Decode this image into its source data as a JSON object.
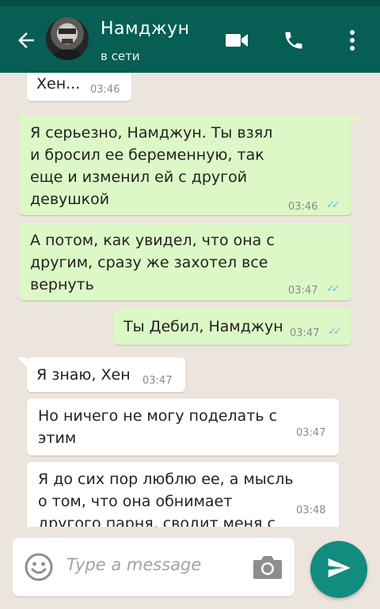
{
  "header": {
    "contact_name": "Намджун",
    "contact_status": "в сети"
  },
  "messages": [
    {
      "direction": "in",
      "text": "Хен...",
      "time": "03:46"
    },
    {
      "direction": "out",
      "lines": [
        "Я серьезно, Намджун. Ты взял",
        "и бросил ее беременную, так",
        "еще и изменил ей с другой",
        "девушкой"
      ],
      "time": "03:46",
      "status": "read"
    },
    {
      "direction": "out",
      "lines": [
        "А потом, как увидел, что она с",
        "другим, сразу же захотел все",
        "вернуть"
      ],
      "time": "03:47",
      "status": "read"
    },
    {
      "direction": "out",
      "text": "Ты Дебил, Намджун",
      "time": "03:47",
      "status": "read"
    },
    {
      "direction": "in",
      "text": "Я знаю, Хен",
      "time": "03:47"
    },
    {
      "direction": "in",
      "lines": [
        "Но ничего не могу поделать с",
        "этим"
      ],
      "time": "03:47"
    },
    {
      "direction": "in",
      "lines": [
        "Я до сих пор люблю ее, а мысль",
        "о том, что она обнимает",
        "другого парня, сводит меня с"
      ],
      "time": "03:48"
    }
  ],
  "composer": {
    "placeholder": "Type a message"
  },
  "icons": {
    "back": "arrow-left-icon",
    "video": "video-camera-icon",
    "call": "phone-icon",
    "menu": "more-vert-icon",
    "emoji": "emoji-icon",
    "camera": "camera-icon",
    "send": "send-icon",
    "read_receipt": "double-check-icon"
  },
  "colors": {
    "appbar": "#075e54",
    "outgoing_bubble": "#dcf8c6",
    "incoming_bubble": "#ffffff",
    "send_button": "#128c7e",
    "read_ticks": "#4fc3f7"
  }
}
